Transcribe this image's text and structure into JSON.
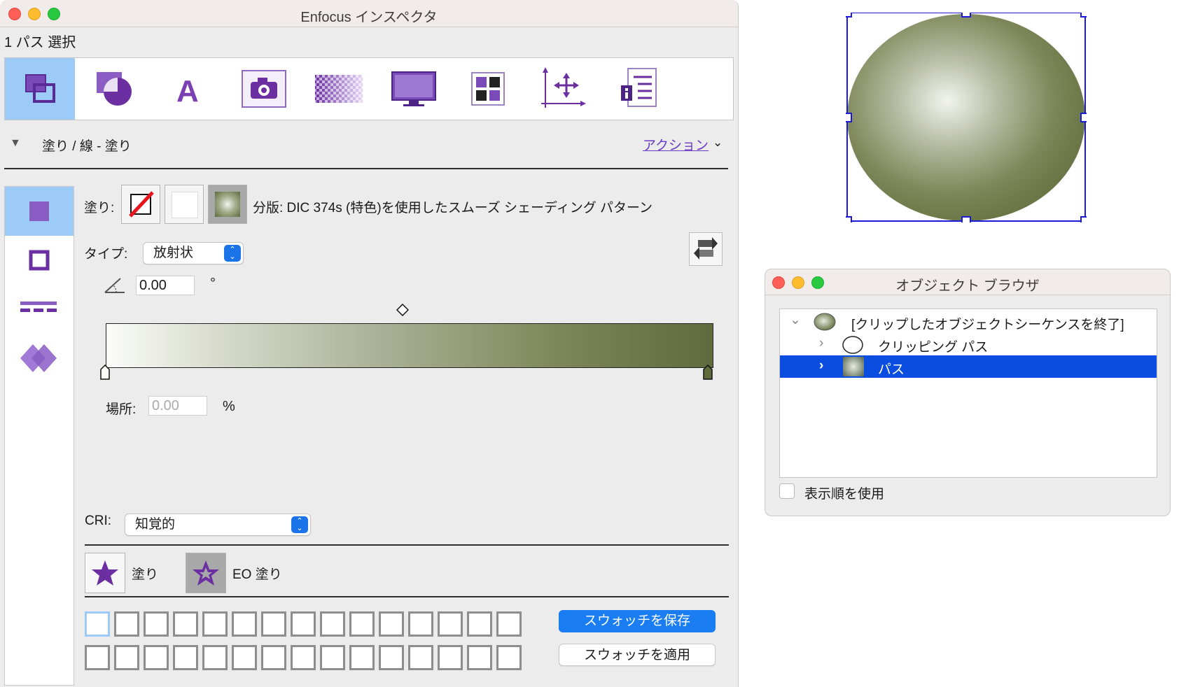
{
  "inspector": {
    "title": "Enfocus インスペクタ",
    "selection_status": "1 パス 選択",
    "toolbar_icons": [
      "fill-stroke-icon",
      "shape-icon",
      "text-icon",
      "image-icon",
      "transparency-icon",
      "display-icon",
      "grid-icon",
      "position-icon",
      "info-icon"
    ],
    "section_title": "塗り / 線 - 塗り",
    "action_link": "アクション",
    "side_tabs": [
      "fill-tab-icon",
      "stroke-tab-icon",
      "dash-tab-icon",
      "overprint-tab-icon"
    ],
    "fill": {
      "label": "塗り:",
      "description": "分版: DIC 374s (特色)を使用したスムーズ シェーディング パターン",
      "type_label": "タイプ:",
      "type_value": "放射状",
      "angle_value": "0.00",
      "angle_unit": "°",
      "location_label": "場所:",
      "location_value": "0.00",
      "location_unit": "%",
      "gradient_start_color": "#fbfcfa",
      "gradient_end_color": "#5f6b3c",
      "cri_label": "CRI:",
      "cri_value": "知覚的",
      "fill_rule_nonzero": "塗り",
      "fill_rule_eo": "EO 塗り"
    },
    "swatches": {
      "rows": 2,
      "per_row": 15,
      "save_button": "スウォッチを保存",
      "apply_button": "スウォッチを適用"
    },
    "colors": {
      "accent": "#1a7df1",
      "selection": "#9ccbf7",
      "icon_purple": "#6b2fa2"
    }
  },
  "object_browser": {
    "title": "オブジェクト ブラウザ",
    "tree": [
      {
        "label": "[クリップしたオブジェクトシーケンスを終了]",
        "expanded": true,
        "selected": false
      },
      {
        "label": "クリッピング パス",
        "expanded": false,
        "selected": false
      },
      {
        "label": "パス",
        "expanded": false,
        "selected": true
      }
    ],
    "checkbox_label": "表示順を使用",
    "checkbox_checked": false
  },
  "canvas": {
    "object": "radial-shaded-ellipse",
    "highlight_color": "#f2f4ee",
    "base_color": "#6a7646",
    "selection_color": "#1a1ad8"
  }
}
